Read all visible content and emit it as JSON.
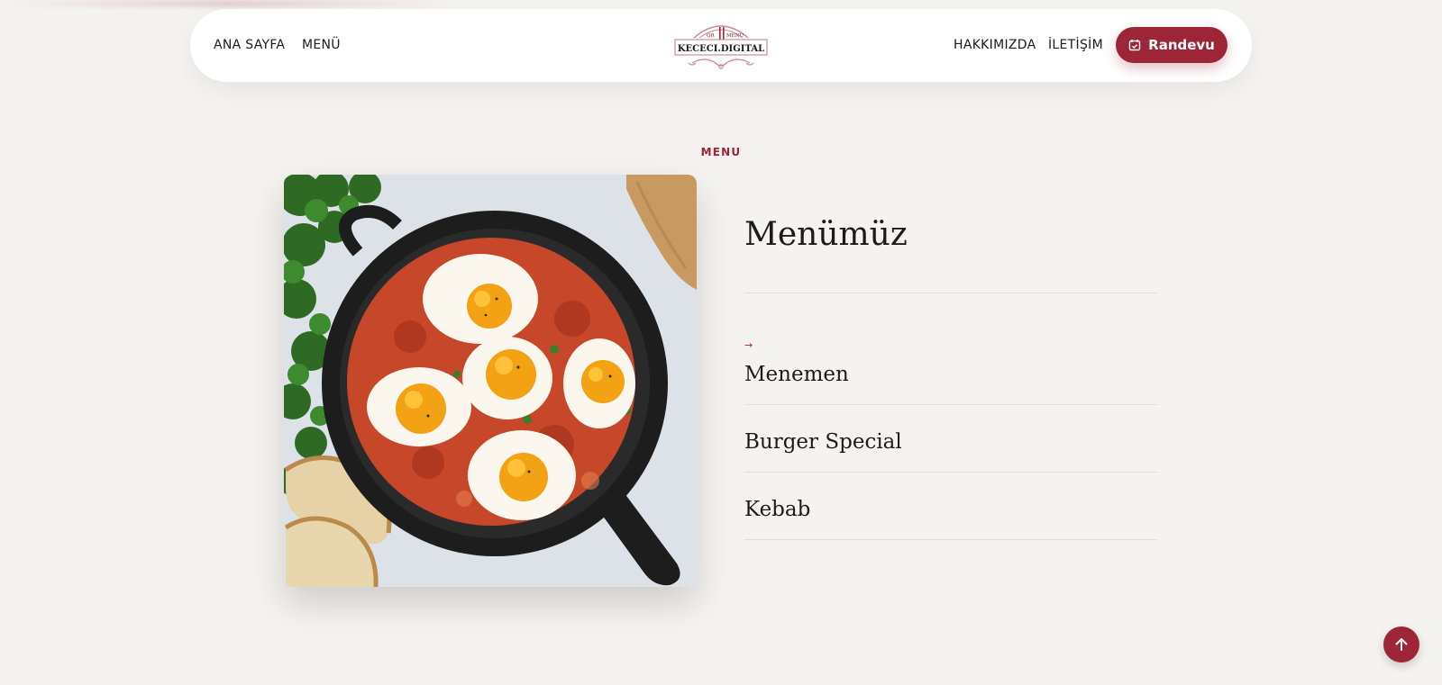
{
  "nav": {
    "home": "ANA SAYFA",
    "menu": "MENÜ",
    "about": "HAKKIMIZDA",
    "contact": "İLETİŞİM",
    "cta_label": "Randevu",
    "cta_icon": "calendar-check-icon"
  },
  "logo": {
    "top_left": "QR",
    "top_right": "MENU",
    "name": "KECECI.DIGITAL"
  },
  "section": {
    "eyebrow": "MENU",
    "title": "Menümüz",
    "items": [
      {
        "label": "Menemen",
        "active": true
      },
      {
        "label": "Burger Special",
        "active": false
      },
      {
        "label": "Kebab",
        "active": false
      }
    ],
    "active_marker": "→"
  },
  "scroll_top_icon": "arrow-up-icon",
  "colors": {
    "accent": "#9c2638",
    "background": "#f5f3ef"
  }
}
